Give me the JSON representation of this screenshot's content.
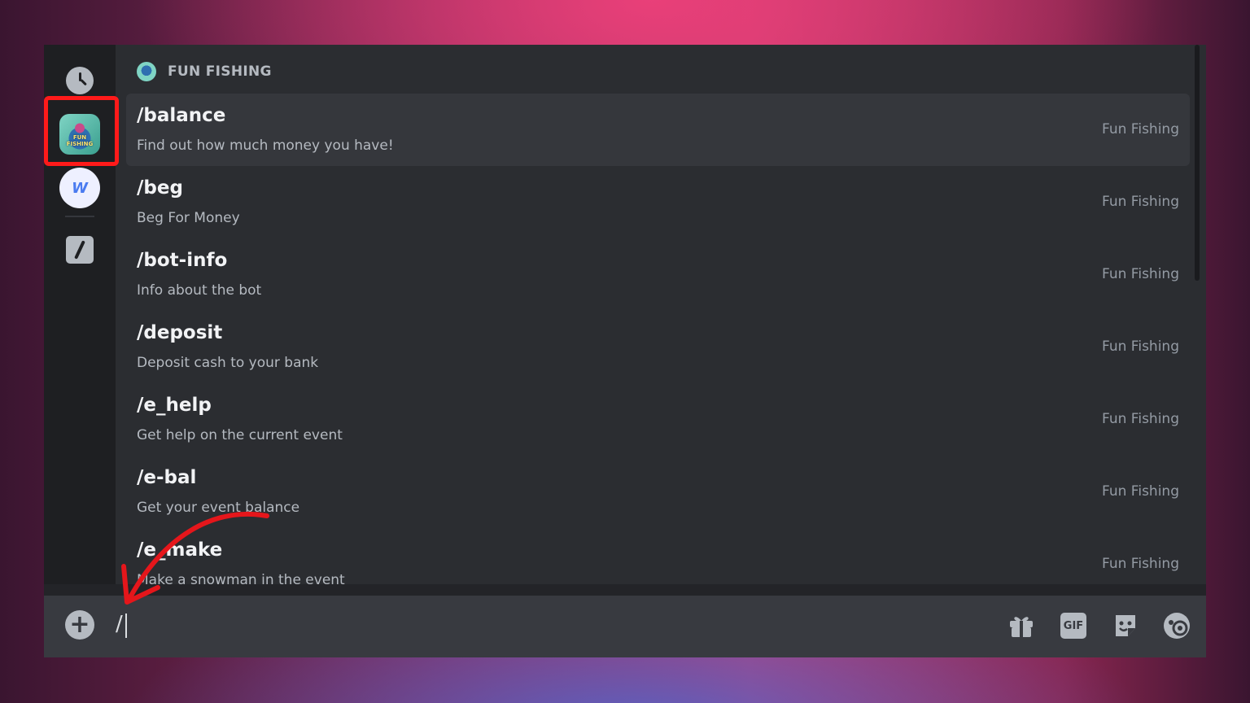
{
  "header": {
    "title": "FUN FISHING"
  },
  "commands": [
    {
      "name": "/balance",
      "description": "Find out how much money you have!",
      "source": "Fun Fishing"
    },
    {
      "name": "/beg",
      "description": "Beg For Money",
      "source": "Fun Fishing"
    },
    {
      "name": "/bot-info",
      "description": "Info about the bot",
      "source": "Fun Fishing"
    },
    {
      "name": "/deposit",
      "description": "Deposit cash to your bank",
      "source": "Fun Fishing"
    },
    {
      "name": "/e_help",
      "description": "Get help on the current event",
      "source": "Fun Fishing"
    },
    {
      "name": "/e-bal",
      "description": "Get your event balance",
      "source": "Fun Fishing"
    },
    {
      "name": "/e_make",
      "description": "Make a snowman in the event",
      "source": "Fun Fishing"
    }
  ],
  "rail": {
    "w_avatar_letter": "W",
    "bot_avatar_text": "FUN FISHING"
  },
  "input": {
    "value": "/"
  },
  "toolbar": {
    "gif_label": "GIF"
  },
  "icons": {
    "recent": "clock-icon",
    "commands": "slash-icon",
    "add": "plus-circle-icon",
    "gift": "gift-icon",
    "gif": "gif-icon",
    "sticker": "sticker-icon",
    "emoji": "emoji-icon"
  },
  "colors": {
    "highlight": "#ff1a1a",
    "window_bg": "#2b2d31",
    "rail_bg": "#1e1f22",
    "selected_row": "#35373c"
  }
}
